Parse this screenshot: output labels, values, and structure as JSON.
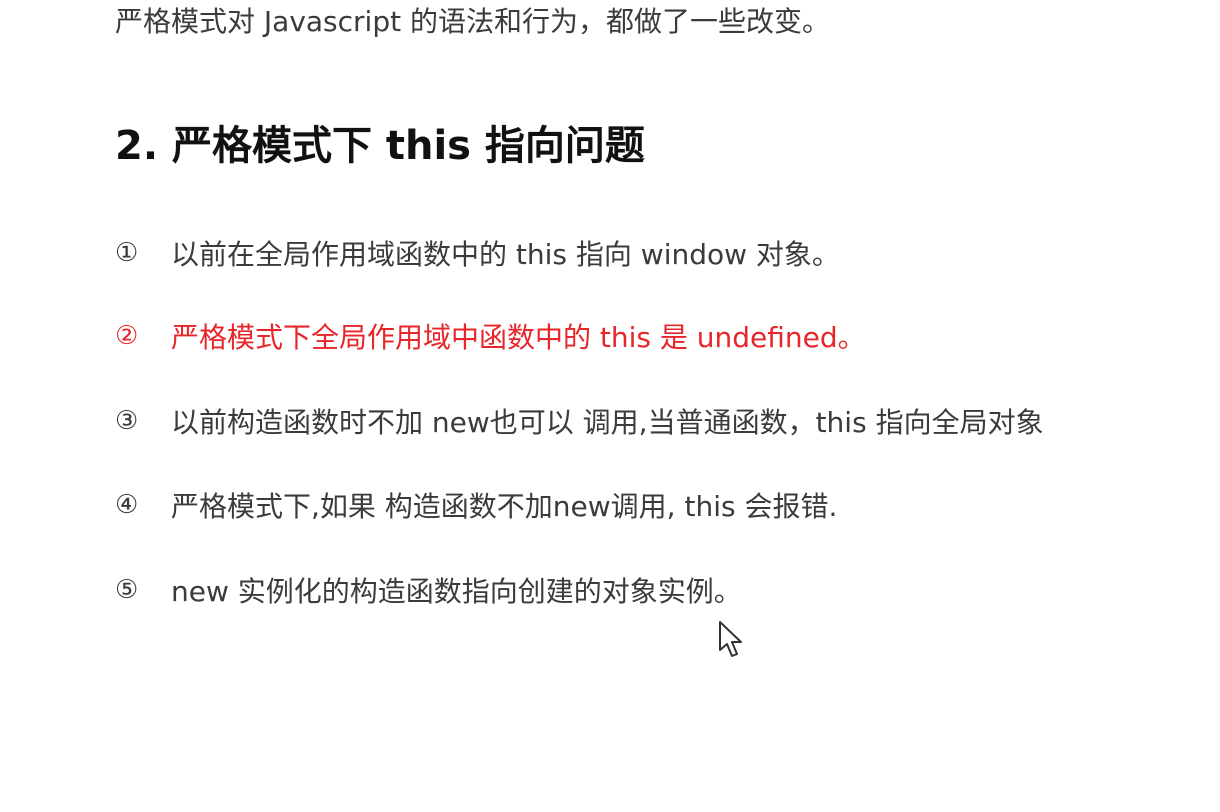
{
  "intro": "严格模式对 Javascript 的语法和行为，都做了一些改变。",
  "heading": "2. 严格模式下 this 指向问题",
  "items": [
    {
      "marker": "①",
      "text": "以前在全局作用域函数中的 this 指向 window 对象。"
    },
    {
      "marker": "②",
      "text": "严格模式下全局作用域中函数中的 this 是 undefined。",
      "color": "#e8262a"
    },
    {
      "marker": "③",
      "text": "以前构造函数时不加 new也可以 调用,当普通函数，this 指向全局对象"
    },
    {
      "marker": "④",
      "text": "严格模式下,如果 构造函数不加new调用, this 会报错."
    },
    {
      "marker": "⑤",
      "text": "new 实例化的构造函数指向创建的对象实例。"
    }
  ],
  "cursor": {
    "icon": "mouse-pointer-icon"
  }
}
